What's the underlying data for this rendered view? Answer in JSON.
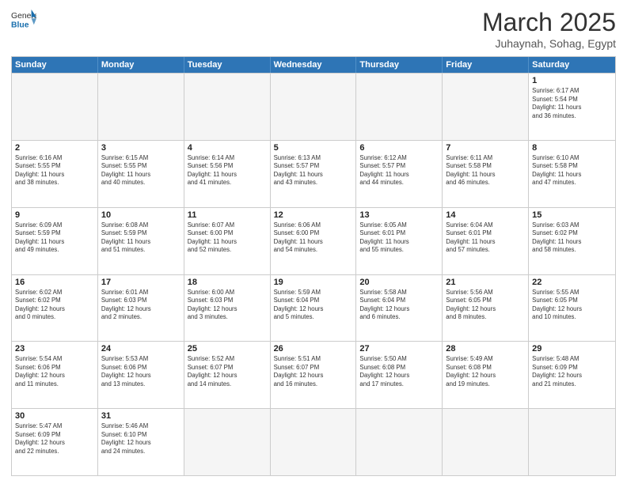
{
  "header": {
    "logo_general": "General",
    "logo_blue": "Blue",
    "month_title": "March 2025",
    "location": "Juhaynah, Sohag, Egypt"
  },
  "days_of_week": [
    "Sunday",
    "Monday",
    "Tuesday",
    "Wednesday",
    "Thursday",
    "Friday",
    "Saturday"
  ],
  "weeks": [
    [
      {
        "day": "",
        "info": ""
      },
      {
        "day": "",
        "info": ""
      },
      {
        "day": "",
        "info": ""
      },
      {
        "day": "",
        "info": ""
      },
      {
        "day": "",
        "info": ""
      },
      {
        "day": "",
        "info": ""
      },
      {
        "day": "1",
        "info": "Sunrise: 6:17 AM\nSunset: 5:54 PM\nDaylight: 11 hours\nand 36 minutes."
      }
    ],
    [
      {
        "day": "2",
        "info": "Sunrise: 6:16 AM\nSunset: 5:55 PM\nDaylight: 11 hours\nand 38 minutes."
      },
      {
        "day": "3",
        "info": "Sunrise: 6:15 AM\nSunset: 5:55 PM\nDaylight: 11 hours\nand 40 minutes."
      },
      {
        "day": "4",
        "info": "Sunrise: 6:14 AM\nSunset: 5:56 PM\nDaylight: 11 hours\nand 41 minutes."
      },
      {
        "day": "5",
        "info": "Sunrise: 6:13 AM\nSunset: 5:57 PM\nDaylight: 11 hours\nand 43 minutes."
      },
      {
        "day": "6",
        "info": "Sunrise: 6:12 AM\nSunset: 5:57 PM\nDaylight: 11 hours\nand 44 minutes."
      },
      {
        "day": "7",
        "info": "Sunrise: 6:11 AM\nSunset: 5:58 PM\nDaylight: 11 hours\nand 46 minutes."
      },
      {
        "day": "8",
        "info": "Sunrise: 6:10 AM\nSunset: 5:58 PM\nDaylight: 11 hours\nand 47 minutes."
      }
    ],
    [
      {
        "day": "9",
        "info": "Sunrise: 6:09 AM\nSunset: 5:59 PM\nDaylight: 11 hours\nand 49 minutes."
      },
      {
        "day": "10",
        "info": "Sunrise: 6:08 AM\nSunset: 5:59 PM\nDaylight: 11 hours\nand 51 minutes."
      },
      {
        "day": "11",
        "info": "Sunrise: 6:07 AM\nSunset: 6:00 PM\nDaylight: 11 hours\nand 52 minutes."
      },
      {
        "day": "12",
        "info": "Sunrise: 6:06 AM\nSunset: 6:00 PM\nDaylight: 11 hours\nand 54 minutes."
      },
      {
        "day": "13",
        "info": "Sunrise: 6:05 AM\nSunset: 6:01 PM\nDaylight: 11 hours\nand 55 minutes."
      },
      {
        "day": "14",
        "info": "Sunrise: 6:04 AM\nSunset: 6:01 PM\nDaylight: 11 hours\nand 57 minutes."
      },
      {
        "day": "15",
        "info": "Sunrise: 6:03 AM\nSunset: 6:02 PM\nDaylight: 11 hours\nand 58 minutes."
      }
    ],
    [
      {
        "day": "16",
        "info": "Sunrise: 6:02 AM\nSunset: 6:02 PM\nDaylight: 12 hours\nand 0 minutes."
      },
      {
        "day": "17",
        "info": "Sunrise: 6:01 AM\nSunset: 6:03 PM\nDaylight: 12 hours\nand 2 minutes."
      },
      {
        "day": "18",
        "info": "Sunrise: 6:00 AM\nSunset: 6:03 PM\nDaylight: 12 hours\nand 3 minutes."
      },
      {
        "day": "19",
        "info": "Sunrise: 5:59 AM\nSunset: 6:04 PM\nDaylight: 12 hours\nand 5 minutes."
      },
      {
        "day": "20",
        "info": "Sunrise: 5:58 AM\nSunset: 6:04 PM\nDaylight: 12 hours\nand 6 minutes."
      },
      {
        "day": "21",
        "info": "Sunrise: 5:56 AM\nSunset: 6:05 PM\nDaylight: 12 hours\nand 8 minutes."
      },
      {
        "day": "22",
        "info": "Sunrise: 5:55 AM\nSunset: 6:05 PM\nDaylight: 12 hours\nand 10 minutes."
      }
    ],
    [
      {
        "day": "23",
        "info": "Sunrise: 5:54 AM\nSunset: 6:06 PM\nDaylight: 12 hours\nand 11 minutes."
      },
      {
        "day": "24",
        "info": "Sunrise: 5:53 AM\nSunset: 6:06 PM\nDaylight: 12 hours\nand 13 minutes."
      },
      {
        "day": "25",
        "info": "Sunrise: 5:52 AM\nSunset: 6:07 PM\nDaylight: 12 hours\nand 14 minutes."
      },
      {
        "day": "26",
        "info": "Sunrise: 5:51 AM\nSunset: 6:07 PM\nDaylight: 12 hours\nand 16 minutes."
      },
      {
        "day": "27",
        "info": "Sunrise: 5:50 AM\nSunset: 6:08 PM\nDaylight: 12 hours\nand 17 minutes."
      },
      {
        "day": "28",
        "info": "Sunrise: 5:49 AM\nSunset: 6:08 PM\nDaylight: 12 hours\nand 19 minutes."
      },
      {
        "day": "29",
        "info": "Sunrise: 5:48 AM\nSunset: 6:09 PM\nDaylight: 12 hours\nand 21 minutes."
      }
    ],
    [
      {
        "day": "30",
        "info": "Sunrise: 5:47 AM\nSunset: 6:09 PM\nDaylight: 12 hours\nand 22 minutes."
      },
      {
        "day": "31",
        "info": "Sunrise: 5:46 AM\nSunset: 6:10 PM\nDaylight: 12 hours\nand 24 minutes."
      },
      {
        "day": "",
        "info": ""
      },
      {
        "day": "",
        "info": ""
      },
      {
        "day": "",
        "info": ""
      },
      {
        "day": "",
        "info": ""
      },
      {
        "day": "",
        "info": ""
      }
    ]
  ]
}
